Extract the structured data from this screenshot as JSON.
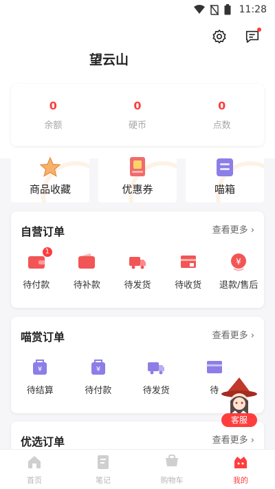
{
  "status": {
    "time": "11:28"
  },
  "header": {
    "username": "望云山"
  },
  "stats": [
    {
      "value": "0",
      "label": "余额"
    },
    {
      "value": "0",
      "label": "硬币"
    },
    {
      "value": "0",
      "label": "点数"
    }
  ],
  "quick": [
    {
      "label": "商品收藏",
      "icon": "star-icon"
    },
    {
      "label": "优惠券",
      "icon": "coupon-icon"
    },
    {
      "label": "喵箱",
      "icon": "box-icon"
    }
  ],
  "self_orders": {
    "title": "自营订单",
    "more": "查看更多",
    "items": [
      {
        "label": "待付款",
        "badge": "1",
        "icon": "wallet-icon"
      },
      {
        "label": "待补款",
        "icon": "wallet-icon"
      },
      {
        "label": "待发货",
        "icon": "truck-icon"
      },
      {
        "label": "待收货",
        "icon": "package-icon"
      },
      {
        "label": "退款/售后",
        "icon": "refund-icon"
      }
    ]
  },
  "reward_orders": {
    "title": "喵赏订单",
    "more": "查看更多",
    "items": [
      {
        "label": "待结算",
        "icon": "bag-icon"
      },
      {
        "label": "待付款",
        "icon": "bag-icon"
      },
      {
        "label": "待发货",
        "icon": "truck-icon"
      },
      {
        "label": "待",
        "icon": "package-icon"
      }
    ]
  },
  "select_orders": {
    "title": "优选订单",
    "more": "查看更多"
  },
  "service": {
    "label": "客服"
  },
  "tabs": [
    {
      "label": "首页",
      "icon": "home-icon"
    },
    {
      "label": "笔记",
      "icon": "note-icon"
    },
    {
      "label": "购物车",
      "icon": "cart-icon"
    },
    {
      "label": "我的",
      "icon": "profile-icon",
      "active": true
    }
  ],
  "colors": {
    "accent": "#ff3d3d",
    "icon_red": "#f25555",
    "icon_purple": "#8c7ee6"
  }
}
